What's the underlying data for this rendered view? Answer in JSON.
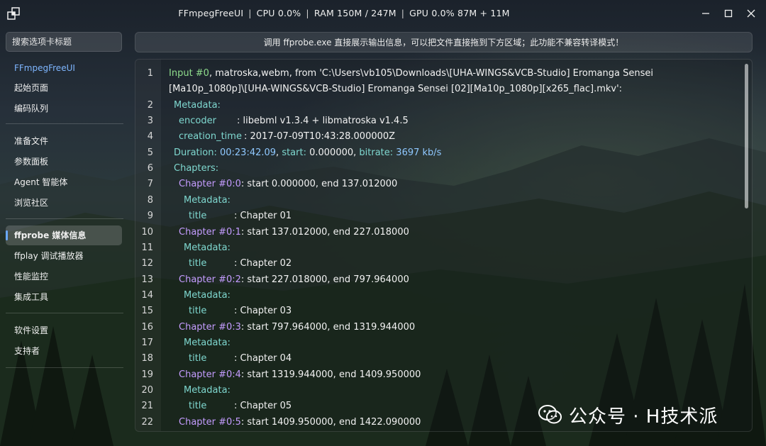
{
  "window": {
    "title_parts": [
      "FFmpegFreeUI",
      "CPU 0.0%",
      "RAM 150M / 247M",
      "GPU 0.0% 87M + 11M"
    ],
    "separator": "|"
  },
  "sidebar": {
    "search_placeholder": "搜索选项卡标题",
    "items": [
      {
        "label": "FFmpegFreeUI"
      },
      {
        "label": "起始页面"
      },
      {
        "label": "编码队列"
      },
      {
        "label": "准备文件"
      },
      {
        "label": "参数面板"
      },
      {
        "label": "Agent 智能体"
      },
      {
        "label": "浏览社区"
      },
      {
        "label": "ffprobe 媒体信息"
      },
      {
        "label": "ffplay 调试播放器"
      },
      {
        "label": "性能监控"
      },
      {
        "label": "集成工具"
      },
      {
        "label": "软件设置"
      },
      {
        "label": "支持者"
      }
    ],
    "active_index": 7
  },
  "banner": {
    "text": "调用 ffprobe.exe 直接展示输出信息，可以把文件直接拖到下方区域；此功能不兼容转译模式！"
  },
  "output": {
    "lines": [
      {
        "n": "1",
        "parts": [
          {
            "t": "Input #0",
            "c": "green"
          },
          {
            "t": ", matroska,webm, from 'C:\\Users\\vb105\\Downloads\\[UHA-WINGS&VCB-Studio] Eromanga Sensei",
            "c": ""
          }
        ]
      },
      {
        "n": "",
        "parts": [
          {
            "t": "[Ma10p_1080p]\\[UHA-WINGS&VCB-Studio] Eromanga Sensei [02][Ma10p_1080p][x265_flac].mkv':",
            "c": ""
          }
        ]
      },
      {
        "n": "2",
        "parts": [
          {
            "t": "Metadata:",
            "c": "cyan",
            "i": 1
          }
        ]
      },
      {
        "n": "3",
        "parts": [
          {
            "t": "encoder",
            "c": "cyan",
            "i": 2,
            "pad": "enc"
          },
          {
            "t": ": libebml v1.3.4 + libmatroska v1.4.5",
            "c": ""
          }
        ]
      },
      {
        "n": "4",
        "parts": [
          {
            "t": "creation_time",
            "c": "cyan",
            "i": 2,
            "pad": "ct"
          },
          {
            "t": ": 2017-07-09T10:43:28.000000Z",
            "c": ""
          }
        ]
      },
      {
        "n": "5",
        "parts": [
          {
            "t": "Duration: ",
            "c": "cyan",
            "i": 1
          },
          {
            "t": "00:23:42.09",
            "c": "lblue"
          },
          {
            "t": ", ",
            "c": ""
          },
          {
            "t": "start: ",
            "c": "cyan"
          },
          {
            "t": "0.000000",
            "c": ""
          },
          {
            "t": ", ",
            "c": ""
          },
          {
            "t": "bitrate: ",
            "c": "cyan"
          },
          {
            "t": "3697 kb/s",
            "c": "lblue"
          }
        ]
      },
      {
        "n": "6",
        "parts": [
          {
            "t": "Chapters:",
            "c": "cyan",
            "i": 1
          }
        ]
      },
      {
        "n": "7",
        "parts": [
          {
            "t": "Chapter #0:0",
            "c": "purple",
            "i": 2
          },
          {
            "t": ": start 0.000000, end 137.012000",
            "c": ""
          }
        ]
      },
      {
        "n": "8",
        "parts": [
          {
            "t": "Metadata:",
            "c": "cyan",
            "i": 3
          }
        ]
      },
      {
        "n": "9",
        "parts": [
          {
            "t": "title",
            "c": "cyan",
            "i": 4,
            "pad": "title"
          },
          {
            "t": ": Chapter 01",
            "c": ""
          }
        ]
      },
      {
        "n": "10",
        "parts": [
          {
            "t": "Chapter #0:1",
            "c": "purple",
            "i": 2
          },
          {
            "t": ": start 137.012000, end 227.018000",
            "c": ""
          }
        ]
      },
      {
        "n": "11",
        "parts": [
          {
            "t": "Metadata:",
            "c": "cyan",
            "i": 3
          }
        ]
      },
      {
        "n": "12",
        "parts": [
          {
            "t": "title",
            "c": "cyan",
            "i": 4,
            "pad": "title"
          },
          {
            "t": ": Chapter 02",
            "c": ""
          }
        ]
      },
      {
        "n": "13",
        "parts": [
          {
            "t": "Chapter #0:2",
            "c": "purple",
            "i": 2
          },
          {
            "t": ": start 227.018000, end 797.964000",
            "c": ""
          }
        ]
      },
      {
        "n": "14",
        "parts": [
          {
            "t": "Metadata:",
            "c": "cyan",
            "i": 3
          }
        ]
      },
      {
        "n": "15",
        "parts": [
          {
            "t": "title",
            "c": "cyan",
            "i": 4,
            "pad": "title"
          },
          {
            "t": ": Chapter 03",
            "c": ""
          }
        ]
      },
      {
        "n": "16",
        "parts": [
          {
            "t": "Chapter #0:3",
            "c": "purple",
            "i": 2
          },
          {
            "t": ": start 797.964000, end 1319.944000",
            "c": ""
          }
        ]
      },
      {
        "n": "17",
        "parts": [
          {
            "t": "Metadata:",
            "c": "cyan",
            "i": 3
          }
        ]
      },
      {
        "n": "18",
        "parts": [
          {
            "t": "title",
            "c": "cyan",
            "i": 4,
            "pad": "title"
          },
          {
            "t": ": Chapter 04",
            "c": ""
          }
        ]
      },
      {
        "n": "19",
        "parts": [
          {
            "t": "Chapter #0:4",
            "c": "purple",
            "i": 2
          },
          {
            "t": ": start 1319.944000, end 1409.950000",
            "c": ""
          }
        ]
      },
      {
        "n": "20",
        "parts": [
          {
            "t": "Metadata:",
            "c": "cyan",
            "i": 3
          }
        ]
      },
      {
        "n": "21",
        "parts": [
          {
            "t": "title",
            "c": "cyan",
            "i": 4,
            "pad": "title"
          },
          {
            "t": ": Chapter 05",
            "c": ""
          }
        ]
      },
      {
        "n": "22",
        "parts": [
          {
            "t": "Chapter #0:5",
            "c": "purple",
            "i": 2
          },
          {
            "t": ": start 1409.950000, end 1422.090000",
            "c": ""
          }
        ]
      }
    ]
  },
  "watermark": {
    "text": "公众号 · H技术派",
    "icon": "wechat-icon"
  },
  "colors": {
    "accent": "#6aa8ff",
    "brand": "#7eb6ff",
    "green": "#8fdc8c",
    "cyan": "#7fd8d0",
    "purple": "#c49cff",
    "value_blue": "#8fc8ff"
  }
}
